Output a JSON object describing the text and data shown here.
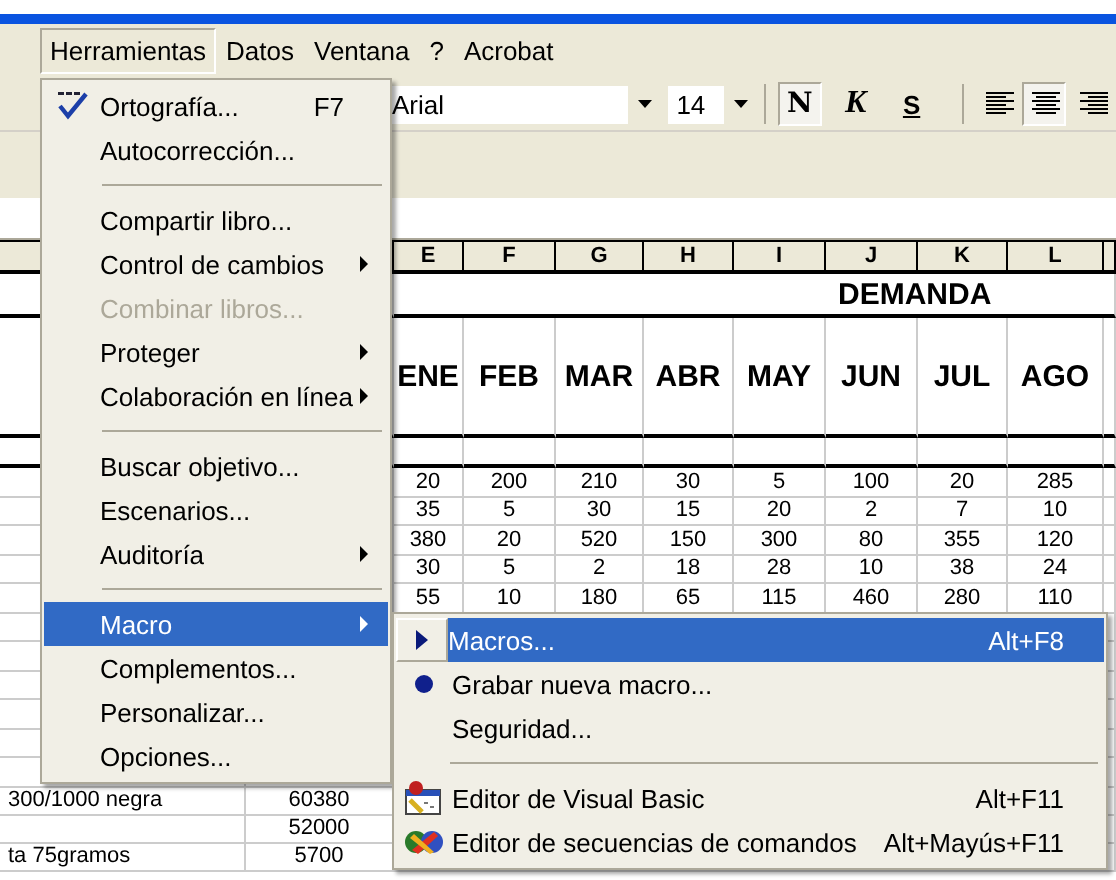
{
  "menu_bar": [
    {
      "label": "Herramientas",
      "selected": true
    },
    {
      "label": "Datos",
      "selected": false
    },
    {
      "label": "Ventana",
      "selected": false
    },
    {
      "label": "?",
      "selected": false
    },
    {
      "label": "Acrobat",
      "selected": false
    }
  ],
  "toolbar": {
    "font": "Arial",
    "size": "14",
    "format_buttons": [
      {
        "label": "N",
        "pressed": true
      },
      {
        "label": "K",
        "pressed": false
      },
      {
        "label": "S",
        "pressed": false
      }
    ],
    "align_buttons": [
      {
        "pressed": false
      },
      {
        "pressed": true
      },
      {
        "pressed": false
      }
    ]
  },
  "sheet": {
    "columns": [
      "E",
      "F",
      "G",
      "H",
      "I",
      "J",
      "K",
      "L"
    ],
    "title": "DEMANDA",
    "months": [
      "ENE",
      "FEB",
      "MAR",
      "ABR",
      "MAY",
      "JUN",
      "JUL",
      "AGO"
    ],
    "rows": [
      [
        "20",
        "200",
        "210",
        "30",
        "5",
        "100",
        "20",
        "285"
      ],
      [
        "35",
        "5",
        "30",
        "15",
        "20",
        "2",
        "7",
        "10"
      ],
      [
        "380",
        "20",
        "520",
        "150",
        "300",
        "80",
        "355",
        "120"
      ],
      [
        "30",
        "5",
        "2",
        "18",
        "28",
        "10",
        "38",
        "24"
      ],
      [
        "55",
        "10",
        "180",
        "65",
        "115",
        "460",
        "280",
        "110"
      ]
    ],
    "bottom_rows": [
      {
        "name": "300/1000 negra",
        "value": "60380"
      },
      {
        "name": "",
        "value": "52000"
      },
      {
        "name": "ta 75gramos",
        "value": "5700"
      }
    ]
  },
  "tools_menu": [
    {
      "kind": "item",
      "label": "Ortografía...",
      "shortcut": "F7",
      "submenu": false,
      "disabled": false,
      "selected": false
    },
    {
      "kind": "item",
      "label": "Autocorrección...",
      "submenu": false,
      "disabled": false,
      "selected": false
    },
    {
      "kind": "separator"
    },
    {
      "kind": "item",
      "label": "Compartir libro...",
      "submenu": false,
      "disabled": false,
      "selected": false
    },
    {
      "kind": "item",
      "label": "Control de cambios",
      "submenu": true,
      "disabled": false,
      "selected": false
    },
    {
      "kind": "item",
      "label": "Combinar libros...",
      "submenu": false,
      "disabled": true,
      "selected": false
    },
    {
      "kind": "item",
      "label": "Proteger",
      "submenu": true,
      "disabled": false,
      "selected": false
    },
    {
      "kind": "item",
      "label": "Colaboración en línea",
      "submenu": true,
      "disabled": false,
      "selected": false
    },
    {
      "kind": "separator"
    },
    {
      "kind": "item",
      "label": "Buscar objetivo...",
      "submenu": false,
      "disabled": false,
      "selected": false
    },
    {
      "kind": "item",
      "label": "Escenarios...",
      "submenu": false,
      "disabled": false,
      "selected": false
    },
    {
      "kind": "item",
      "label": "Auditoría",
      "submenu": true,
      "disabled": false,
      "selected": false
    },
    {
      "kind": "separator"
    },
    {
      "kind": "item",
      "label": "Macro",
      "submenu": true,
      "disabled": false,
      "selected": true
    },
    {
      "kind": "item",
      "label": "Complementos...",
      "submenu": false,
      "disabled": false,
      "selected": false
    },
    {
      "kind": "item",
      "label": "Personalizar...",
      "submenu": false,
      "disabled": false,
      "selected": false
    },
    {
      "kind": "item",
      "label": "Opciones...",
      "submenu": false,
      "disabled": false,
      "selected": false
    }
  ],
  "macro_menu": [
    {
      "kind": "item",
      "label": "Macros...",
      "shortcut": "Alt+F8",
      "selected": true
    },
    {
      "kind": "item",
      "label": "Grabar nueva macro...",
      "selected": false
    },
    {
      "kind": "item",
      "label": "Seguridad...",
      "selected": false
    },
    {
      "kind": "separator"
    },
    {
      "kind": "item",
      "label": "Editor de Visual Basic",
      "shortcut": "Alt+F11",
      "selected": false
    },
    {
      "kind": "item",
      "label": "Editor de secuencias de comandos",
      "shortcut": "Alt+Mayús+F11",
      "selected": false
    }
  ]
}
